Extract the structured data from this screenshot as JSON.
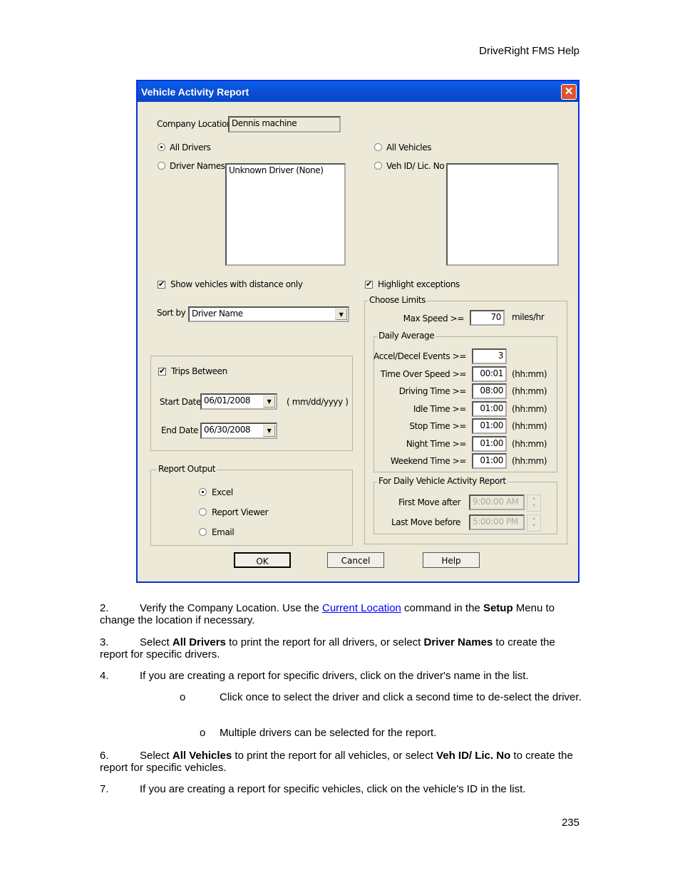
{
  "header": "DriveRight FMS Help",
  "page_number": "235",
  "dialog": {
    "title": "Vehicle Activity Report",
    "company_location_label": "Company Location",
    "company_location": "Dennis machine",
    "all_drivers": "All Drivers",
    "driver_names": "Driver Names",
    "driver_list": [
      "Unknown Driver (None)"
    ],
    "all_vehicles": "All Vehicles",
    "veh_id": "Veh ID/ Lic. No",
    "show_distance": "Show vehicles with distance only",
    "highlight": "Highlight exceptions",
    "sort_by_label": "Sort by",
    "sort_by": "Driver Name",
    "trips_between": "Trips Between",
    "start_date_label": "Start Date",
    "start_date": "06/01/2008",
    "date_format": "( mm/dd/yyyy )",
    "end_date_label": "End Date",
    "end_date": "06/30/2008",
    "report_output": "Report Output",
    "excel": "Excel",
    "report_viewer": "Report Viewer",
    "email": "Email",
    "choose_limits": "Choose Limits",
    "max_speed_label": "Max Speed >=",
    "max_speed": "70",
    "max_speed_unit": "miles/hr",
    "daily_average": "Daily Average",
    "limits": [
      {
        "label": "Accel/Decel Events >=",
        "value": "3",
        "unit": ""
      },
      {
        "label": "Time Over Speed >=",
        "value": "00:01",
        "unit": "(hh:mm)"
      },
      {
        "label": "Driving Time >=",
        "value": "08:00",
        "unit": "(hh:mm)"
      },
      {
        "label": "Idle Time >=",
        "value": "01:00",
        "unit": "(hh:mm)"
      },
      {
        "label": "Stop Time >=",
        "value": "01:00",
        "unit": "(hh:mm)"
      },
      {
        "label": "Night Time >=",
        "value": "01:00",
        "unit": "(hh:mm)"
      },
      {
        "label": "Weekend Time >=",
        "value": "01:00",
        "unit": "(hh:mm)"
      }
    ],
    "daily_vehicle": "For Daily Vehicle Activity Report",
    "first_move_label": "First Move after",
    "first_move": "9:00:00 AM",
    "last_move_label": "Last Move before",
    "last_move": "5:00:00 PM",
    "ok": "OK",
    "cancel": "Cancel",
    "help": "Help"
  },
  "steps": {
    "s2": {
      "num": "2.",
      "a": "Verify the Company Location. Use the ",
      "link": "Current Location",
      "b": " command in the ",
      "bold": "Setup",
      "c": " Menu to change the location if necessary."
    },
    "s3": {
      "num": "3.",
      "a": "Select ",
      "b1": "All Drivers",
      "b": " to print the report for all drivers, or select ",
      "b2": "Driver Names",
      "c": " to create the report for specific drivers."
    },
    "s4": {
      "num": "4.",
      "text": "If you are creating a report for specific drivers, click on the driver's name in the list."
    },
    "bullets": [
      "Click once to select the driver and click a second time to de-select the driver.",
      "Multiple drivers can be selected for the report."
    ],
    "bullet_char": "o",
    "s6": {
      "num": "6.",
      "a": "Select ",
      "b1": "All Vehicles",
      "b": " to print the report for all vehicles, or select ",
      "b2": "Veh ID/ Lic. No",
      "c": " to create the report for specific vehicles."
    },
    "s7": {
      "num": "7.",
      "text": "If you are creating a report for specific vehicles, click on the vehicle's ID in the list."
    }
  }
}
